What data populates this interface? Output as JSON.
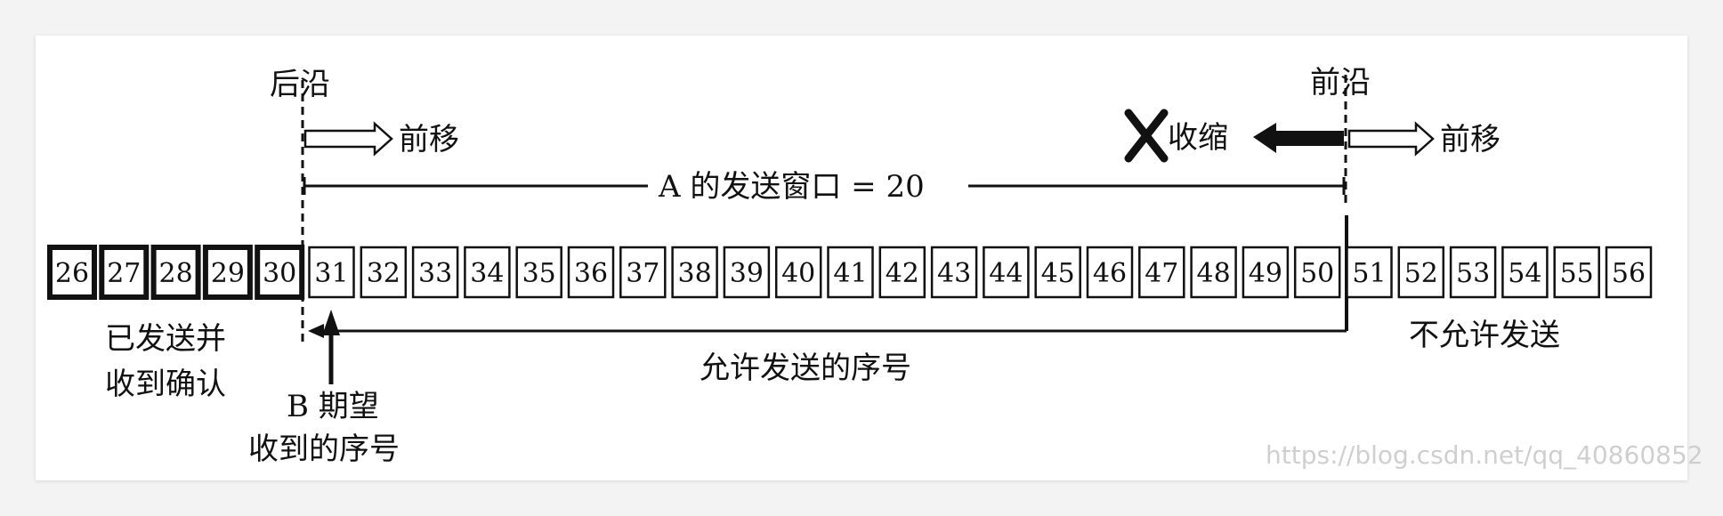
{
  "labels": {
    "trailing_edge": "后沿",
    "leading_edge": "前沿",
    "move_forward_left": "前移",
    "move_forward_right": "前移",
    "shrink": "收缩",
    "window": "A 的发送窗口 = 20",
    "sent_acked_line1": "已发送并",
    "sent_acked_line2": "收到确认",
    "allowed": "允许发送的序号",
    "not_allowed": "不允许发送",
    "b_expect_line1": "B 期望",
    "b_expect_line2": "收到的序号",
    "watermark": "https://blog.csdn.net/qq_40860852"
  },
  "sequence": {
    "acked": [
      "26",
      "27",
      "28",
      "29",
      "30"
    ],
    "allowed": [
      "31",
      "32",
      "33",
      "34",
      "35",
      "36",
      "37",
      "38",
      "39",
      "40",
      "41",
      "42",
      "43",
      "44",
      "45",
      "46",
      "47",
      "48",
      "49",
      "50"
    ],
    "not_allowed": [
      "51",
      "52",
      "53",
      "54",
      "55",
      "56"
    ]
  },
  "icons": {
    "shrink_mark": "x-mark-icon",
    "hollow_arrow": "hollow-right-arrow-icon",
    "solid_arrow": "solid-left-arrow-icon",
    "up_arrow": "up-arrow-icon"
  },
  "colors": {
    "ink": "#111111",
    "background": "#ffffff",
    "watermark": "#cfcfcf"
  }
}
